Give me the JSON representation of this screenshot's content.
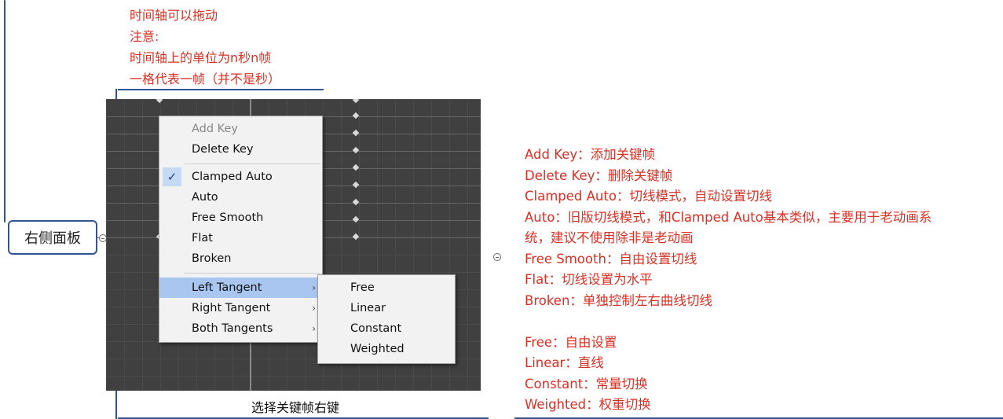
{
  "top_note": [
    "时间轴可以拖动",
    "注意:",
    "时间轴上的单位为n秒n帧",
    "一格代表一帧（并不是秒）"
  ],
  "main_node": {
    "label": "右侧面板"
  },
  "context_menu": {
    "items": [
      {
        "label": "Add Key",
        "enabled": false
      },
      {
        "label": "Delete Key"
      },
      {
        "label": "Clamped Auto",
        "checked": true
      },
      {
        "label": "Auto"
      },
      {
        "label": "Free Smooth"
      },
      {
        "label": "Flat"
      },
      {
        "label": "Broken"
      },
      {
        "label": "Left Tangent",
        "submenu": true,
        "highlighted": true
      },
      {
        "label": "Right Tangent",
        "submenu": true
      },
      {
        "label": "Both Tangents",
        "submenu": true
      }
    ],
    "checkmark": "✓",
    "submenu_arrow": "›"
  },
  "sub_menu": {
    "items": [
      {
        "label": "Free"
      },
      {
        "label": "Linear"
      },
      {
        "label": "Constant"
      },
      {
        "label": "Weighted"
      }
    ]
  },
  "caption": "选择关键帧右键",
  "right_note": [
    "Add Key：添加关键帧",
    "Delete Key：删除关键帧",
    "Clamped Auto：切线模式，自动设置切线",
    "Auto：旧版切线模式，和Clamped Auto基本类似，主要用于老动画系",
    "统，建议不使用除非是老动画",
    "Free Smooth：自由设置切线",
    "Flat：切线设置为水平",
    "Broken：单独控制左右曲线切线",
    "",
    "Free：自由设置",
    "Linear：直线",
    "Constant：常量切换",
    "Weighted：权重切换"
  ],
  "colors": {
    "note_red": "#d93025",
    "branch_blue": "#2f5597",
    "menu_highlight": "#a8c6ef"
  }
}
